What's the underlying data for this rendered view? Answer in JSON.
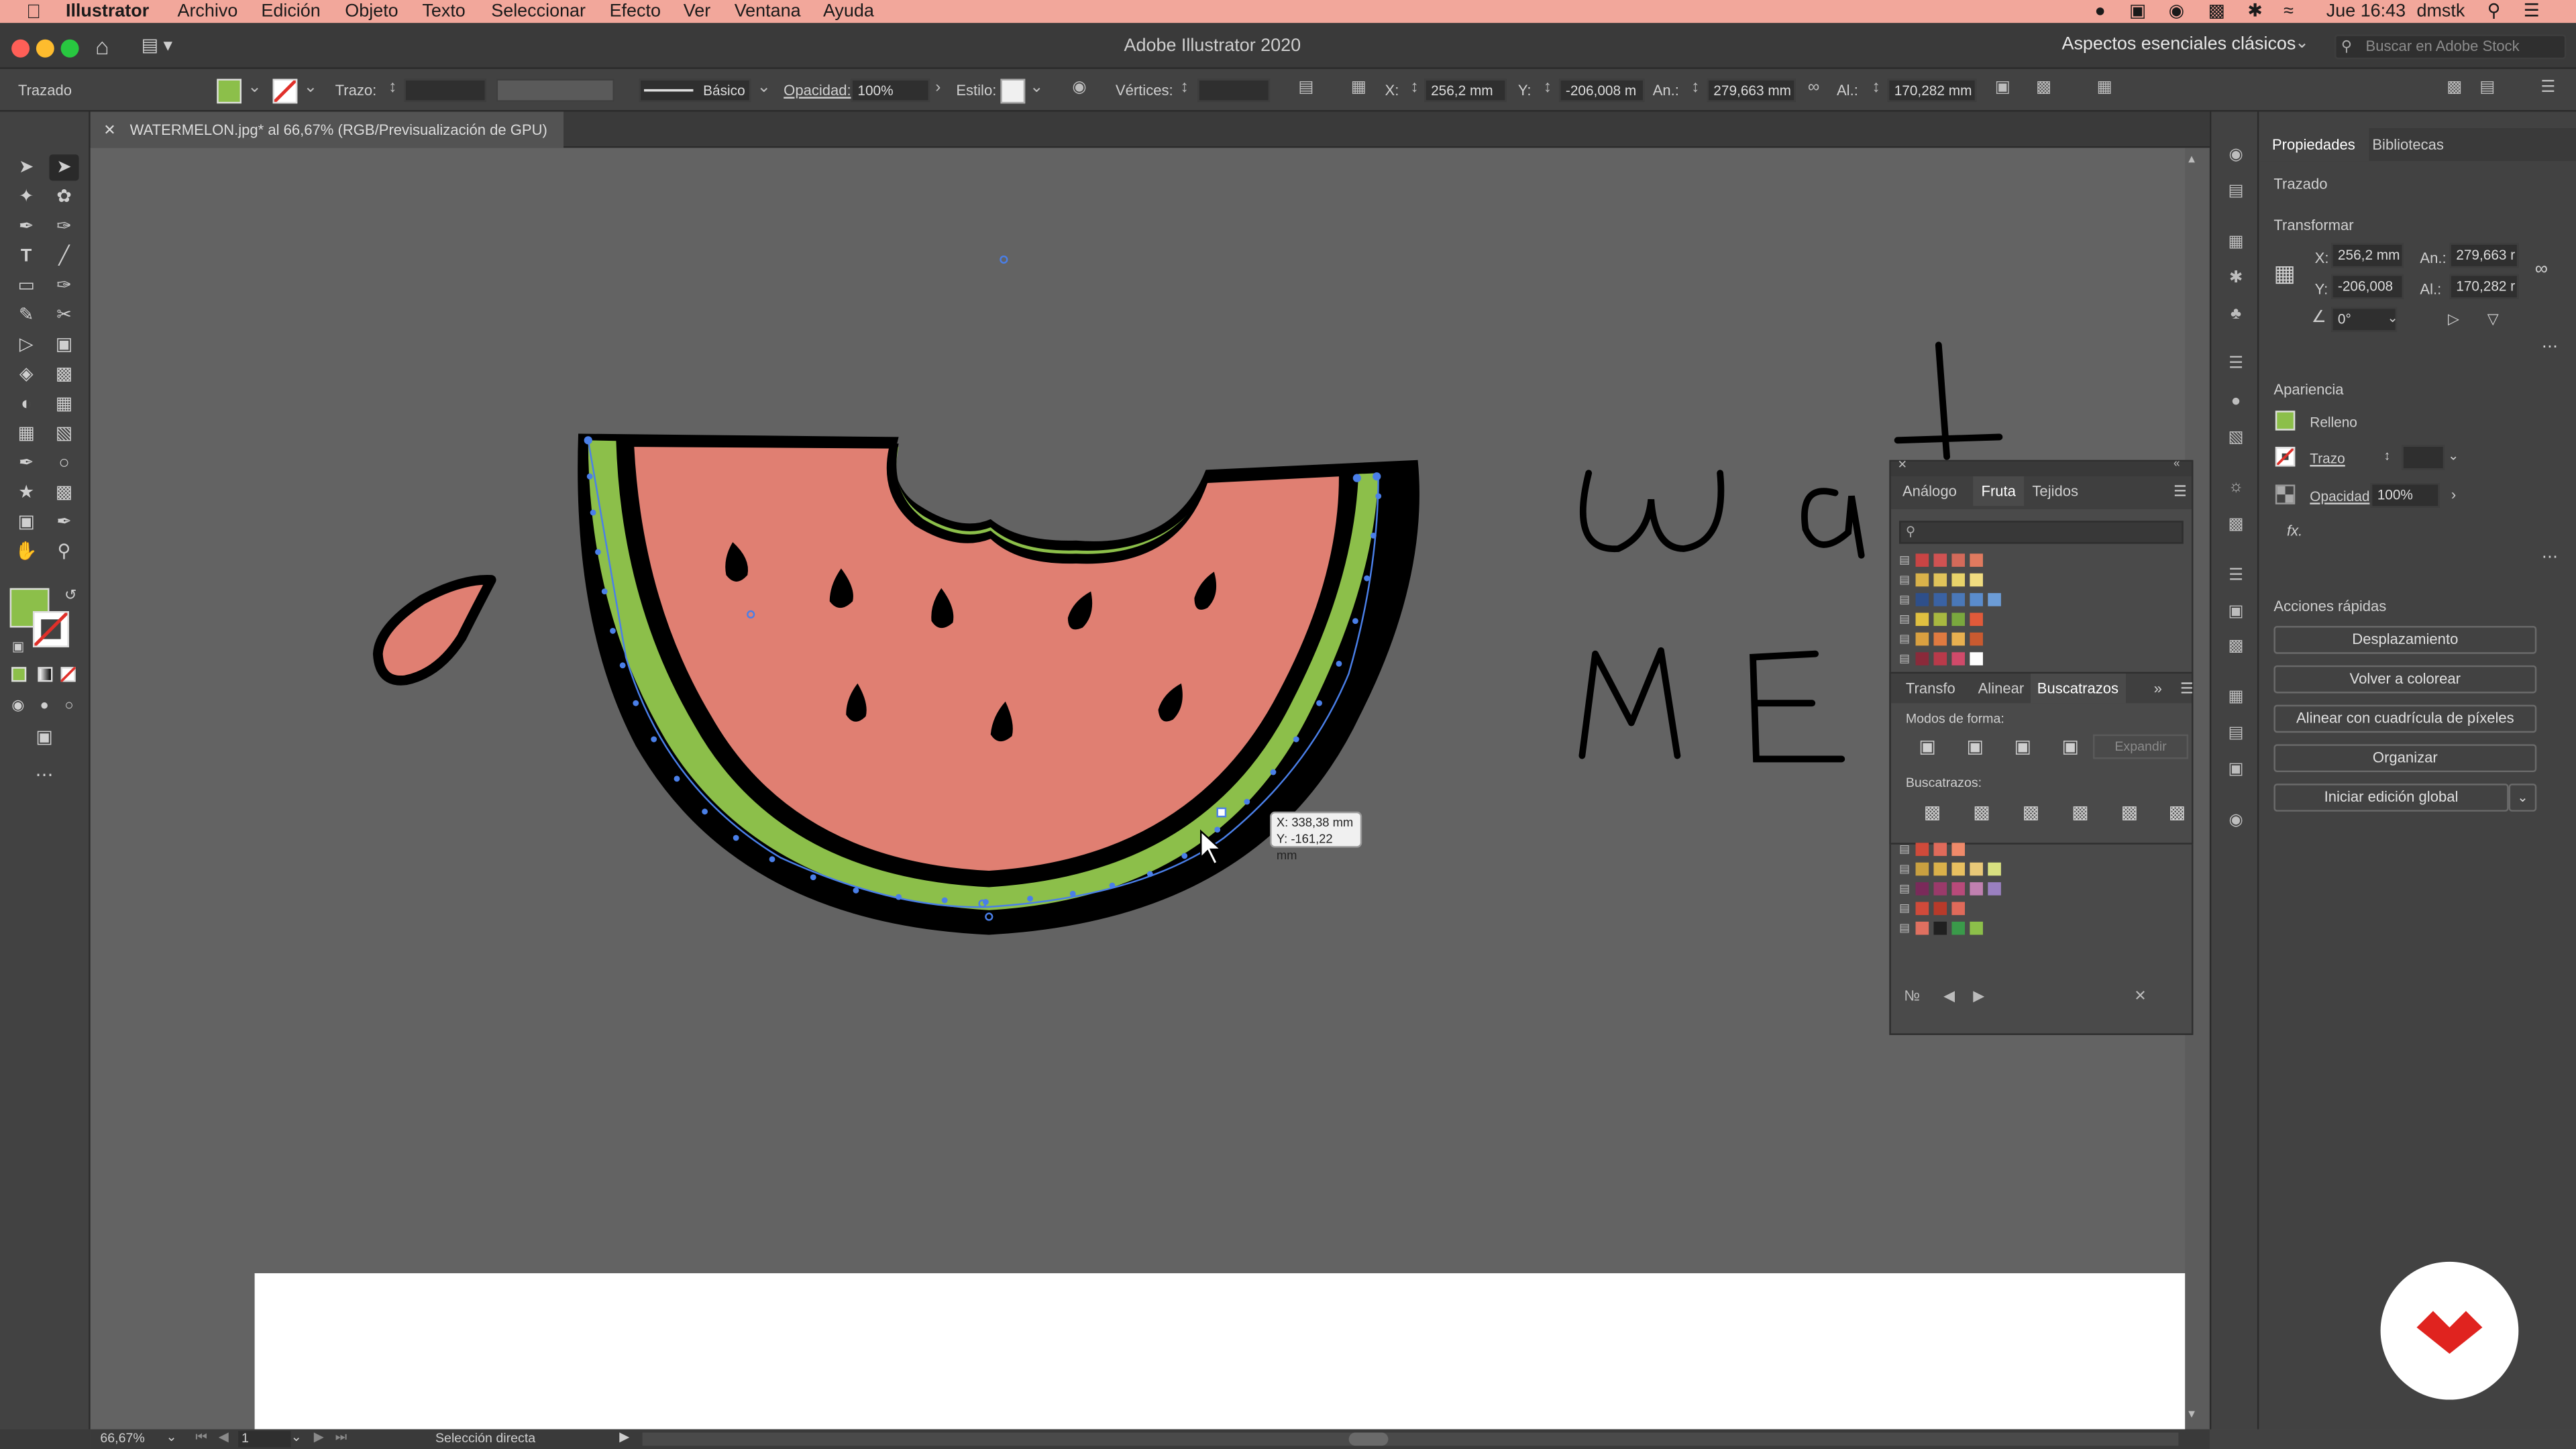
{
  "menubar": {
    "app_name": "Illustrator",
    "menus": [
      "Archivo",
      "Edición",
      "Objeto",
      "Texto",
      "Seleccionar",
      "Efecto",
      "Ver",
      "Ventana",
      "Ayuda"
    ],
    "clock": "Jue 16:43",
    "user": "dmstk"
  },
  "titlebar": {
    "title": "Adobe Illustrator 2020",
    "workspace": "Aspectos esenciales clásicos",
    "search_placeholder": "Buscar en Adobe Stock"
  },
  "controlbar": {
    "selection_type": "Trazado",
    "fill_color": "#8cbf4a",
    "stroke_label": "Trazo:",
    "stroke_style": "Básico",
    "opacity_label": "Opacidad:",
    "opacity_value": "100%",
    "style_label": "Estilo:",
    "vertices_label": "Vértices:",
    "x_label": "X:",
    "x_value": "256,2 mm",
    "y_label": "Y:",
    "y_value": "-206,008 m",
    "w_label": "An.:",
    "w_value": "279,663 mm",
    "h_label": "Al.:",
    "h_value": "170,282 mm"
  },
  "document": {
    "tab_title": "WATERMELON.jpg* al 66,67% (RGB/Previsualización de GPU)"
  },
  "canvas": {
    "cursor_tooltip_x": "X: 338,38 mm",
    "cursor_tooltip_y": "Y: -161,22 mm",
    "hand_letters_line1": "wat",
    "hand_letters_line2": "ME"
  },
  "swatches_panel": {
    "tabs": [
      "Análogo",
      "Fruta",
      "Tejidos"
    ],
    "active_tab": "Fruta",
    "groups_top": [
      [
        "#c94444",
        "#d05252",
        "#d46a5a",
        "#e07a5f"
      ],
      [
        "#d9b24a",
        "#e0c35a",
        "#e8d36a",
        "#f0dc80"
      ],
      [
        "#2e4f8a",
        "#3a62a3",
        "#4a78b8",
        "#5a8ccc",
        "#6c9cd6"
      ],
      [
        "#e0c040",
        "#a8b840",
        "#7aa83e",
        "#e05a3a"
      ],
      [
        "#d9a040",
        "#e07a40",
        "#e8b050",
        "#c95a30"
      ],
      [
        "#8a2a3a",
        "#b83a4a",
        "#d04a6a",
        "#ffffff"
      ]
    ],
    "groups_bottom": [
      [
        "#d04a3a",
        "#e06a5a",
        "#f08a6a"
      ],
      [
        "#c9a040",
        "#d9b04a",
        "#e8c060",
        "#e8c878",
        "#d8e080"
      ],
      [
        "#7a2a5a",
        "#9a3a6a",
        "#b84a7a",
        "#c080b0",
        "#9a80c0"
      ],
      [
        "#d04a3a",
        "#b83a2a",
        "#e06a5a"
      ],
      [
        "#e07060",
        "#202020",
        "#3a9a4a",
        "#8cbf4a"
      ]
    ]
  },
  "pathfinder_panel": {
    "tabs": [
      "Transfo",
      "Alinear",
      "Buscatrazos"
    ],
    "active_tab": "Buscatrazos",
    "shape_modes_label": "Modos de forma:",
    "expand_label": "Expandir",
    "pathfinders_label": "Buscatrazos:"
  },
  "properties": {
    "tabs": [
      "Propiedades",
      "Bibliotecas"
    ],
    "selection_type": "Trazado",
    "transform_title": "Transformar",
    "x_label": "X:",
    "x_value": "256,2 mm",
    "y_label": "Y:",
    "y_value": "-206,008",
    "w_label": "An.:",
    "w_value": "279,663 r",
    "h_label": "Al.:",
    "h_value": "170,282 r",
    "angle_value": "0°",
    "appearance_title": "Apariencia",
    "fill_label": "Relleno",
    "stroke_label": "Trazo",
    "opacity_label": "Opacidad",
    "opacity_value": "100%",
    "fx_label": "fx.",
    "quick_actions_title": "Acciones rápidas",
    "buttons": [
      "Desplazamiento",
      "Volver a colorear",
      "Alinear con cuadrícula de píxeles",
      "Organizar",
      "Iniciar edición global"
    ]
  },
  "status": {
    "zoom": "66,67%",
    "artboard": "1",
    "tool_name": "Selección directa"
  },
  "colors": {
    "watermelon_flesh": "#e07f72",
    "watermelon_rind": "#8cbf4a",
    "outline": "#000000",
    "selection": "#4a7fe8"
  }
}
